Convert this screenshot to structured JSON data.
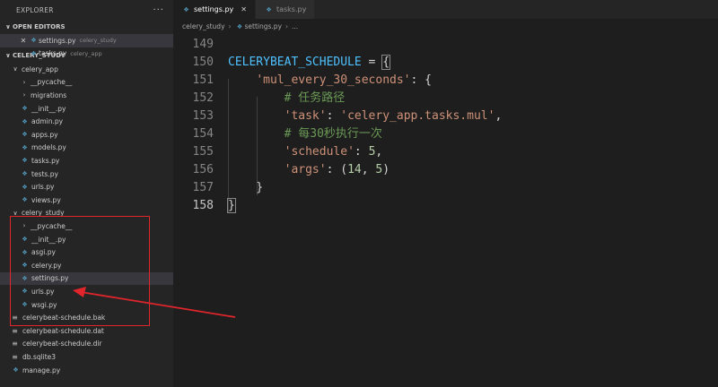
{
  "explorer": {
    "title": "EXPLORER",
    "more_actions": "···",
    "open_editors": {
      "title": "OPEN EDITORS",
      "items": [
        {
          "name": "settings.py",
          "desc": "celery_study",
          "active": true,
          "icon": "python-file-icon"
        },
        {
          "name": "tasks.py",
          "desc": "celery_app",
          "active": false,
          "icon": "python-file-icon"
        }
      ]
    },
    "project": {
      "title": "CELERY_STUDY",
      "tree": [
        {
          "label": "celery_app",
          "type": "folder-open",
          "depth": 1
        },
        {
          "label": "__pycache__",
          "type": "folder-closed",
          "depth": 2
        },
        {
          "label": "migrations",
          "type": "folder-closed",
          "depth": 2
        },
        {
          "label": "__init__.py",
          "type": "py",
          "depth": 2
        },
        {
          "label": "admin.py",
          "type": "py",
          "depth": 2
        },
        {
          "label": "apps.py",
          "type": "py",
          "depth": 2
        },
        {
          "label": "models.py",
          "type": "py",
          "depth": 2
        },
        {
          "label": "tasks.py",
          "type": "py",
          "depth": 2
        },
        {
          "label": "tests.py",
          "type": "py",
          "depth": 2
        },
        {
          "label": "urls.py",
          "type": "py",
          "depth": 2
        },
        {
          "label": "views.py",
          "type": "py",
          "depth": 2
        },
        {
          "label": "celery_study",
          "type": "folder-open",
          "depth": 1
        },
        {
          "label": "__pycache__",
          "type": "folder-closed",
          "depth": 2
        },
        {
          "label": "__init__.py",
          "type": "py",
          "depth": 2
        },
        {
          "label": "asgi.py",
          "type": "py",
          "depth": 2
        },
        {
          "label": "celery.py",
          "type": "py",
          "depth": 2
        },
        {
          "label": "settings.py",
          "type": "py",
          "depth": 2,
          "selected": true
        },
        {
          "label": "urls.py",
          "type": "py",
          "depth": 2
        },
        {
          "label": "wsgi.py",
          "type": "py",
          "depth": 2
        },
        {
          "label": "celerybeat-schedule.bak",
          "type": "file",
          "depth": 1
        },
        {
          "label": "celerybeat-schedule.dat",
          "type": "file",
          "depth": 1
        },
        {
          "label": "celerybeat-schedule.dir",
          "type": "file",
          "depth": 1
        },
        {
          "label": "db.sqlite3",
          "type": "file",
          "depth": 1
        },
        {
          "label": "manage.py",
          "type": "py",
          "depth": 1
        }
      ]
    }
  },
  "tabs": [
    {
      "label": "settings.py",
      "active": true,
      "close": "✕"
    },
    {
      "label": "tasks.py",
      "active": false
    }
  ],
  "breadcrumb": {
    "folder": "celery_study",
    "file": "settings.py",
    "symbol": "..."
  },
  "editor": {
    "lines": [
      {
        "num": "149",
        "tokens": []
      },
      {
        "num": "150",
        "tokens": [
          {
            "t": "CELERYBEAT_SCHEDULE",
            "c": "var"
          },
          {
            "t": " = ",
            "c": "op"
          },
          {
            "t": "{",
            "c": "brace match"
          }
        ]
      },
      {
        "num": "151",
        "tokens": [
          {
            "t": "    ",
            "c": "op"
          },
          {
            "t": "'mul_every_30_seconds'",
            "c": "str"
          },
          {
            "t": ": {",
            "c": "op"
          }
        ]
      },
      {
        "num": "152",
        "tokens": [
          {
            "t": "        ",
            "c": "op"
          },
          {
            "t": "# 任务路径",
            "c": "com"
          }
        ]
      },
      {
        "num": "153",
        "tokens": [
          {
            "t": "        ",
            "c": "op"
          },
          {
            "t": "'task'",
            "c": "str"
          },
          {
            "t": ": ",
            "c": "op"
          },
          {
            "t": "'celery_app.tasks.mul'",
            "c": "str"
          },
          {
            "t": ",",
            "c": "op"
          }
        ]
      },
      {
        "num": "154",
        "tokens": [
          {
            "t": "        ",
            "c": "op"
          },
          {
            "t": "# 每30秒执行一次",
            "c": "com"
          }
        ]
      },
      {
        "num": "155",
        "tokens": [
          {
            "t": "        ",
            "c": "op"
          },
          {
            "t": "'schedule'",
            "c": "str"
          },
          {
            "t": ": ",
            "c": "op"
          },
          {
            "t": "5",
            "c": "num"
          },
          {
            "t": ",",
            "c": "op"
          }
        ]
      },
      {
        "num": "156",
        "tokens": [
          {
            "t": "        ",
            "c": "op"
          },
          {
            "t": "'args'",
            "c": "str"
          },
          {
            "t": ": (",
            "c": "op"
          },
          {
            "t": "14",
            "c": "num"
          },
          {
            "t": ", ",
            "c": "op"
          },
          {
            "t": "5",
            "c": "num"
          },
          {
            "t": ")",
            "c": "op"
          }
        ]
      },
      {
        "num": "157",
        "tokens": [
          {
            "t": "    }",
            "c": "op"
          }
        ]
      },
      {
        "num": "158",
        "tokens": [
          {
            "t": "}",
            "c": "brace match"
          }
        ],
        "current": true
      }
    ]
  },
  "colors": {
    "annotation": "#e0252b",
    "python_icon": "#519aba"
  }
}
